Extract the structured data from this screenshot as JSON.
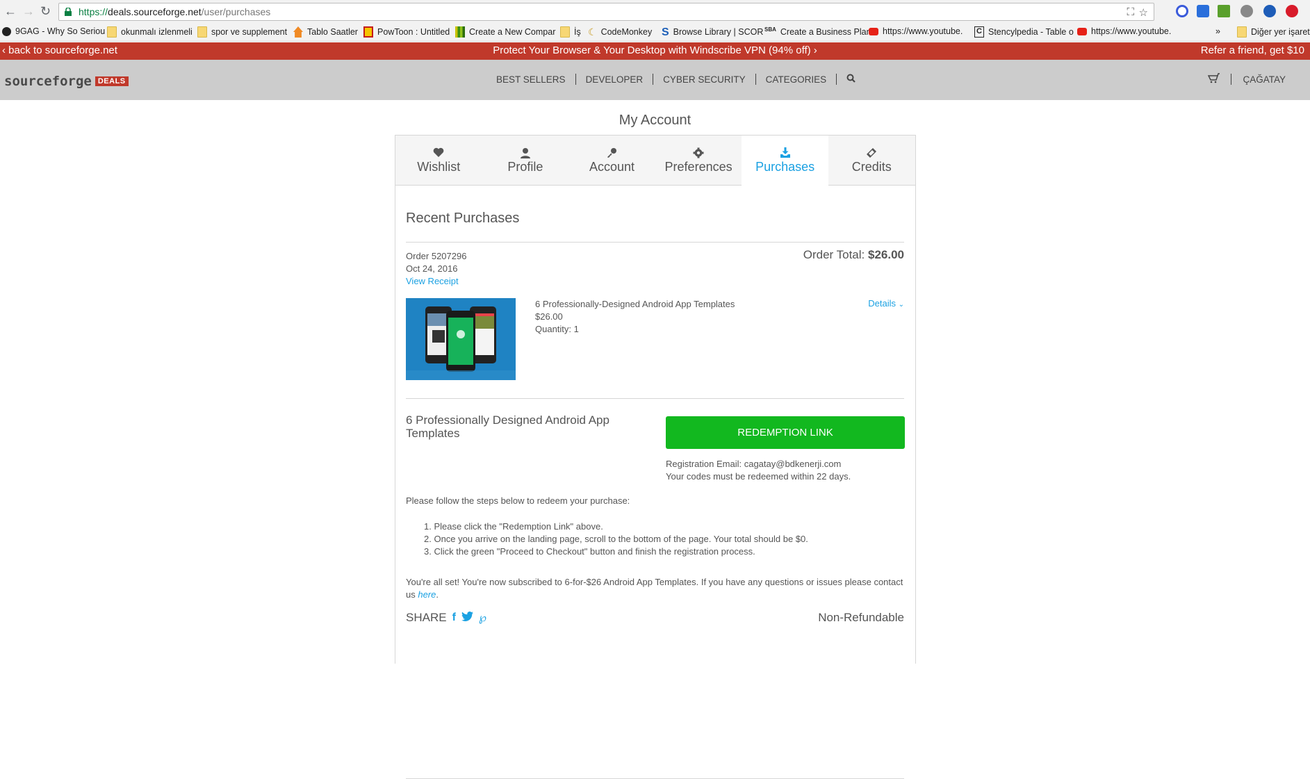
{
  "browser": {
    "url_scheme": "https://",
    "url_host": "deals.sourceforge.net",
    "url_path": "/user/purchases",
    "bookmarks": [
      {
        "label": "9GAG - Why So Seriou",
        "icon": "9gag-icon"
      },
      {
        "label": "okunmalı izlenmeli",
        "icon": "folder-icon"
      },
      {
        "label": "spor ve supplement",
        "icon": "folder-icon"
      },
      {
        "label": "Tablo Saatler",
        "icon": "home-icon"
      },
      {
        "label": "PowToon : Untitled",
        "icon": "powtoon-icon"
      },
      {
        "label": "Create a New Compar",
        "icon": "bars-icon"
      },
      {
        "label": "İş",
        "icon": "folder-icon"
      },
      {
        "label": "CodeMonkey",
        "icon": "banana-icon"
      },
      {
        "label": "Browse Library | SCOR",
        "icon": "s-icon"
      },
      {
        "label": "Create a Business Plan",
        "icon": "sba-icon"
      },
      {
        "label": "https://www.youtube.",
        "icon": "youtube-icon"
      },
      {
        "label": "Stencylpedia - Table o",
        "icon": "stencyl-icon"
      },
      {
        "label": "https://www.youtube.",
        "icon": "youtube-icon"
      }
    ],
    "overflow": "»",
    "other_bookmarks": "Diğer yer işaretl"
  },
  "promo": {
    "back": "back to sourceforge.net",
    "center": "Protect Your Browser & Your Desktop with Windscribe VPN (94% off)",
    "refer": "Refer a friend, get $10"
  },
  "nav": {
    "logo_word": "sourceforge",
    "logo_badge": "DEALS",
    "items": [
      "BEST SELLERS",
      "DEVELOPER",
      "CYBER SECURITY",
      "CATEGORIES"
    ],
    "user": "ÇAĞATAY"
  },
  "account": {
    "title": "My Account",
    "tabs": [
      {
        "label": "Wishlist",
        "icon": "heart-icon",
        "glyph": "♥"
      },
      {
        "label": "Profile",
        "icon": "user-icon",
        "glyph": "👤"
      },
      {
        "label": "Account",
        "icon": "key-icon",
        "glyph": "🔑"
      },
      {
        "label": "Preferences",
        "icon": "gear-icon",
        "glyph": "⚙"
      },
      {
        "label": "Purchases",
        "icon": "download-icon",
        "glyph": "⤓"
      },
      {
        "label": "Credits",
        "icon": "ticket-icon",
        "glyph": "◈"
      }
    ],
    "active_tab": "Purchases"
  },
  "purchases": {
    "heading": "Recent Purchases",
    "order_number": "Order 5207296",
    "order_date": "Oct 24, 2016",
    "view_receipt": "View Receipt",
    "order_total_label": "Order Total:",
    "order_total_value": "$26.00",
    "product_name": "6 Professionally-Designed Android App Templates",
    "product_price": "$26.00",
    "product_quantity": "Quantity: 1",
    "details_label": "Details",
    "redeem_title": "6 Professionally Designed Android App Templates",
    "redeem_button": "REDEMPTION LINK",
    "registration_email": "Registration Email: cagatay@bdkenerji.com",
    "redeem_within": "Your codes must be redeemed within 22 days.",
    "steps_intro": "Please follow the steps below to redeem your purchase:",
    "steps": [
      "1. Please click the \"Redemption Link\" above.",
      "2. Once you arrive on the landing page, scroll to the bottom of the page. Your total should be $0.",
      "3. Click the green \"Proceed to Checkout\" button and finish the registration process."
    ],
    "final_text": "You're all set! You're now subscribed to 6-for-$26 Android App Templates. If you have any questions or issues please contact us ",
    "contact_link": "here",
    "share_label": "SHARE",
    "non_refundable": "Non-Refundable"
  },
  "colors": {
    "brand_red": "#c0392b",
    "link_blue": "#1ba1e2",
    "button_green": "#12b81f",
    "nav_gray": "#cccccc"
  }
}
